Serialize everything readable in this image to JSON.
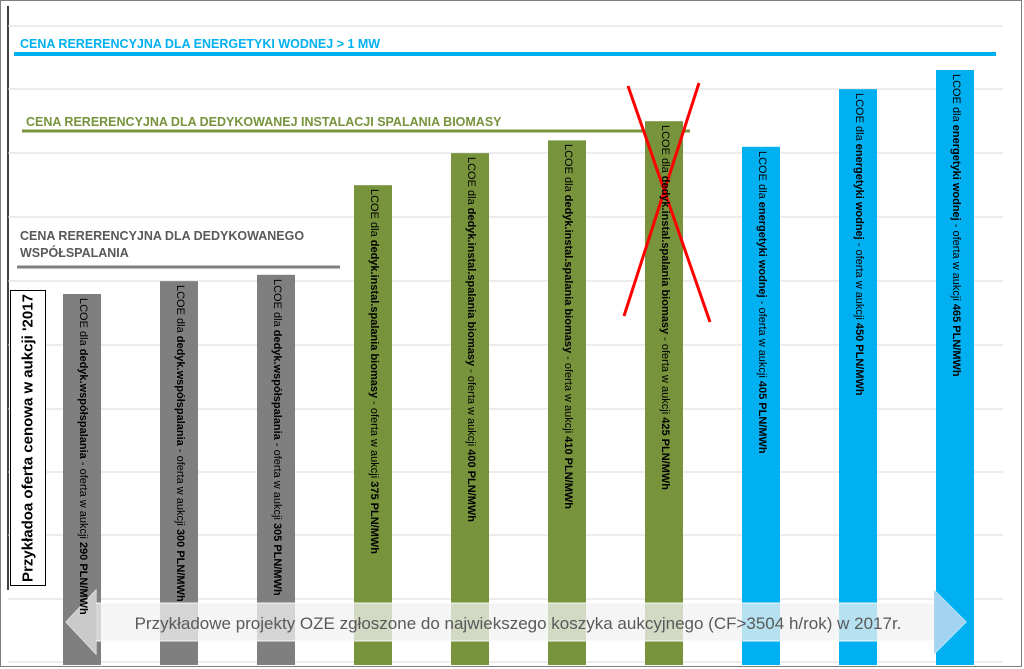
{
  "chart_data": {
    "type": "bar",
    "ylabel": "Przykładoa oferta cenowa w aukcji  '2017",
    "xlabel": "Przykładowe projekty OZE zgłoszone do najwiekszego koszyka aukcyjnego (CF>3504 h/rok) w 2017r.",
    "values": [
      290,
      300,
      305,
      375,
      400,
      410,
      425,
      405,
      450,
      465
    ],
    "bar_colors": [
      "#7f7f7f",
      "#7f7f7f",
      "#7f7f7f",
      "#77933c",
      "#77933c",
      "#77933c",
      "#77933c",
      "#00b0f0",
      "#00b0f0",
      "#00b0f0"
    ],
    "bar_labels": [
      {
        "pre": "LCOE dla ",
        "bold": "dedyk.współspalania",
        "post": " - oferta w aukcji ",
        "val": "290 PLN/MWh"
      },
      {
        "pre": "LCOE dla ",
        "bold": "dedyk.współspalania",
        "post": " - oferta w aukcji ",
        "val": "300 PLN/MWh"
      },
      {
        "pre": "LCOE dla ",
        "bold": "dedyk.współspalania",
        "post": " - oferta w aukcji ",
        "val": "305 PLN/MWh"
      },
      {
        "pre": "LCOE dla ",
        "bold": "dedyk.instal.spalania biomasy",
        "post": " - oferta w aukcji ",
        "val": "375 PLN/MWh"
      },
      {
        "pre": "LCOE dla ",
        "bold": "dedyk.instal.spalania biomasy",
        "post": " - oferta w aukcji ",
        "val": "400 PLN/MWh"
      },
      {
        "pre": "LCOE dla ",
        "bold": "dedyk.instal.spalania biomasy",
        "post": " - oferta w aukcji ",
        "val": "410 PLN/MWh"
      },
      {
        "pre": "LCOE dla ",
        "bold": "dedyk.instal.spalania biomasy",
        "post": " - oferta w aukcji ",
        "val": "425 PLN/MWh"
      },
      {
        "pre": "LCOE dla ",
        "bold": "energetyki wodnej",
        "post": " - oferta w aukcji ",
        "val": "405 PLN/MWh"
      },
      {
        "pre": "LCOE dla ",
        "bold": "energetyki wodnej",
        "post": " - oferta w aukcji ",
        "val": "450 PLN/MWh"
      },
      {
        "pre": "LCOE dla ",
        "bold": "energetyki wodnej",
        "post": " - oferta w aukcji ",
        "val": "465 PLN/MWh"
      }
    ],
    "crossed_out_index": 6,
    "reference_lines": [
      {
        "label": "CENA RERERENCYJNA DLA ENERGETYKI WODNEJ > 1 MW",
        "color": "#00b0f0"
      },
      {
        "label": "CENA RERERENCYJNA DLA DEDYKOWANEJ INSTALACJI SPALANIA BIOMASY",
        "color": "#77933c"
      },
      {
        "label": "CENA RERERENCYJNA DLA DEDYKOWANEGO WSPÓŁSPALANIA",
        "color": "#7f7f7f"
      }
    ],
    "grid": true
  }
}
